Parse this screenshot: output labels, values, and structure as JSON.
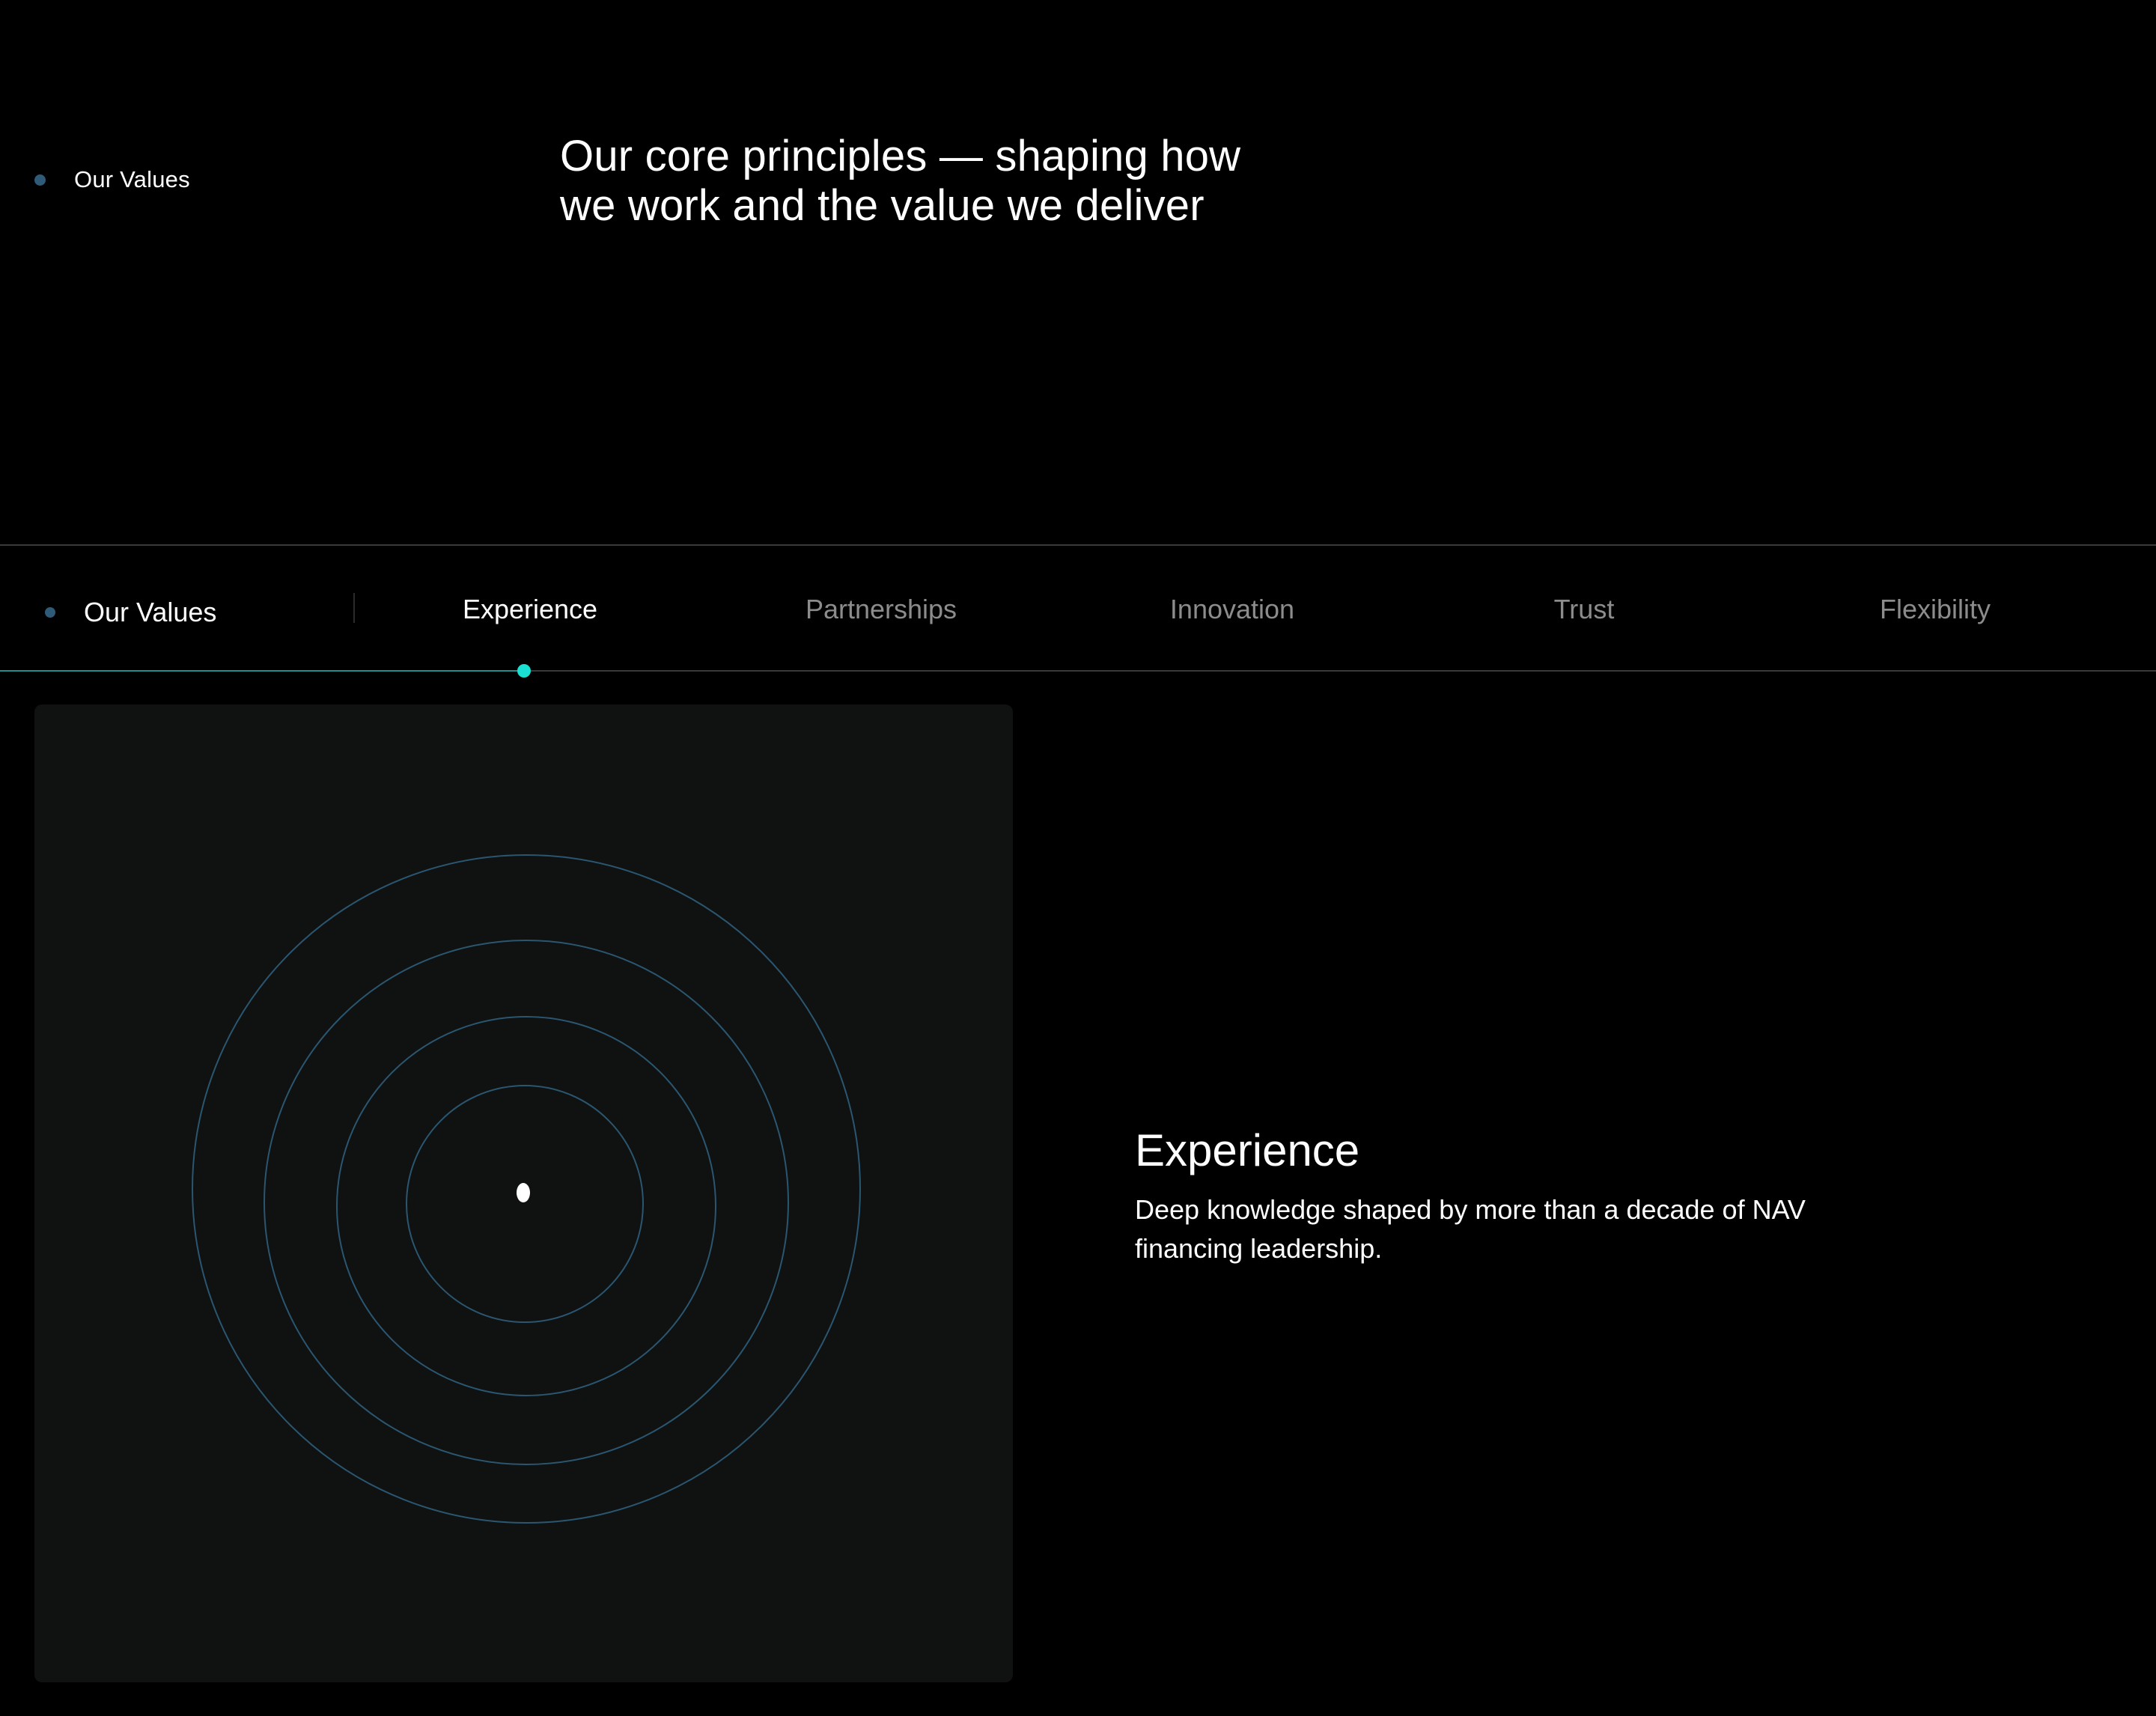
{
  "intro": {
    "label": "Our Values",
    "headline_line1": "Our core principles — shaping how",
    "headline_line2": "we work and the value we deliver"
  },
  "tabbar": {
    "label": "Our Values",
    "tabs": [
      {
        "label": "Experience",
        "active": true
      },
      {
        "label": "Partnerships",
        "active": false
      },
      {
        "label": "Innovation",
        "active": false
      },
      {
        "label": "Trust",
        "active": false
      },
      {
        "label": "Flexibility",
        "active": false
      }
    ],
    "progress_fraction": 0.243
  },
  "detail": {
    "title": "Experience",
    "description_line1": "Deep knowledge shaped by more than a decade of NAV",
    "description_line2": "financing leadership."
  },
  "colors": {
    "background": "#000000",
    "card": "#101111",
    "accent": "#19e0d2",
    "ring": "#2a5670",
    "dot": "#2f5a78",
    "inactive_text": "#8c8c8c"
  },
  "icons": {
    "illustration": "concentric-rings-illustration"
  }
}
